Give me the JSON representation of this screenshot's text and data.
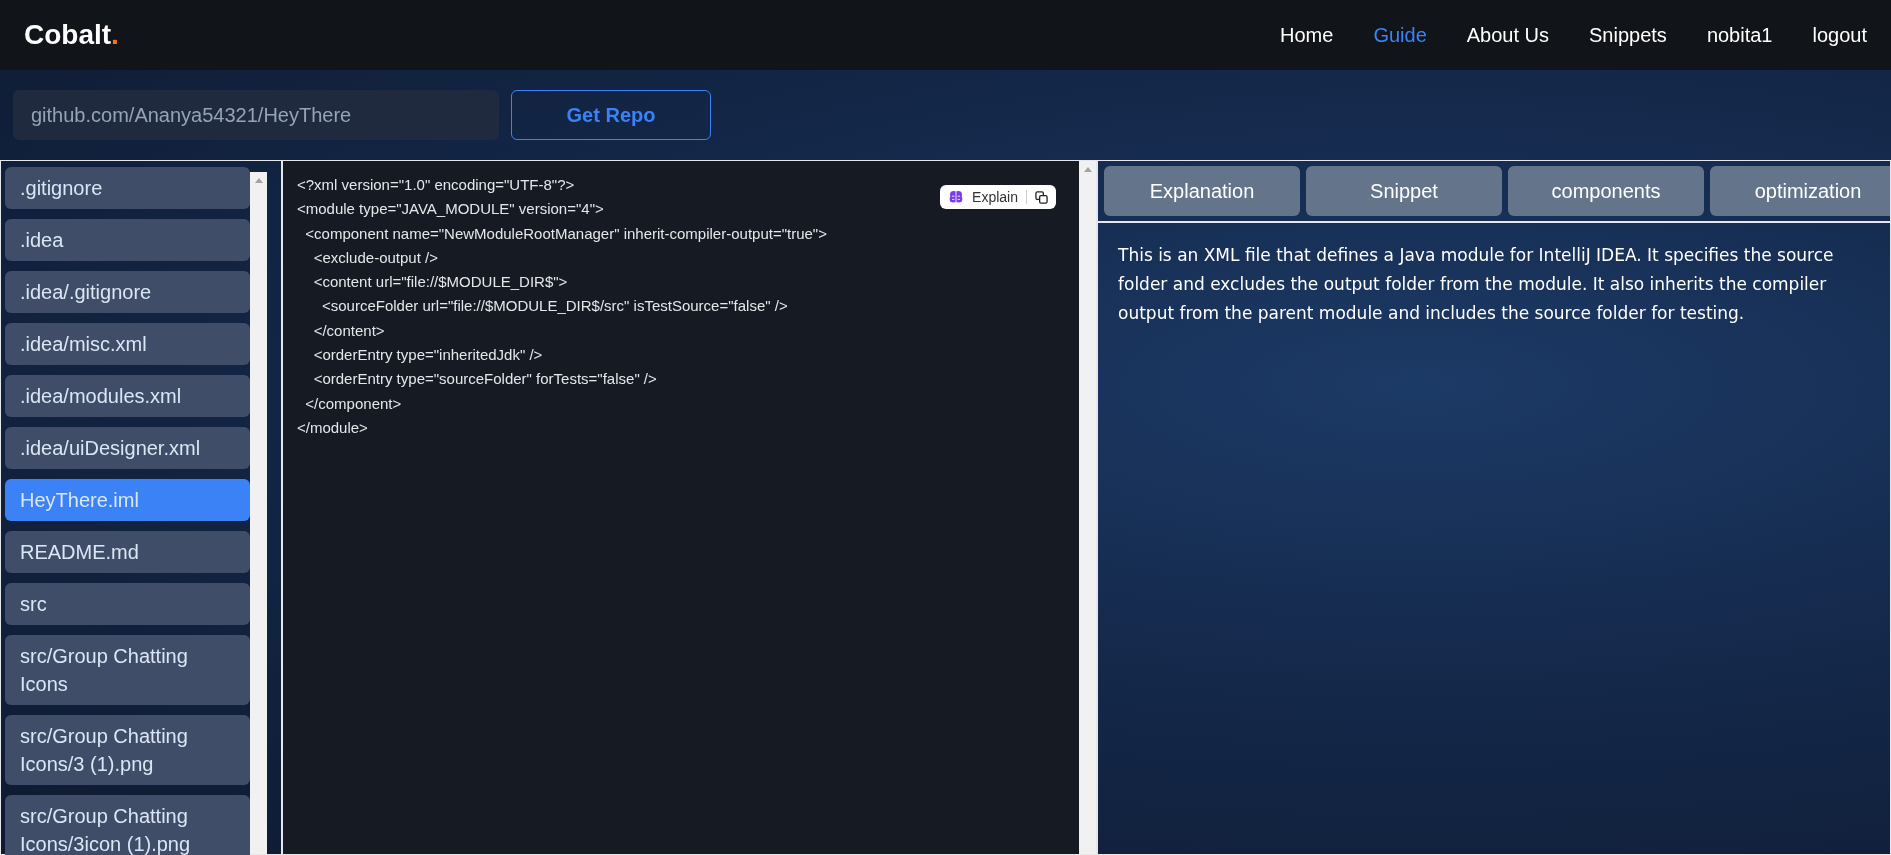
{
  "brand": {
    "name": "Cobalt",
    "dot": "."
  },
  "nav": [
    {
      "label": "Home",
      "selected": false
    },
    {
      "label": "Guide",
      "selected": true
    },
    {
      "label": "About Us",
      "selected": false
    },
    {
      "label": "Snippets",
      "selected": false
    },
    {
      "label": "nobita1",
      "selected": false
    },
    {
      "label": "logout",
      "selected": false
    }
  ],
  "repo": {
    "value": "github.com/Ananya54321/HeyThere",
    "button": "Get Repo"
  },
  "files": [
    {
      "name": ".gitignore",
      "selected": false
    },
    {
      "name": ".idea",
      "selected": false
    },
    {
      "name": ".idea/.gitignore",
      "selected": false
    },
    {
      "name": ".idea/misc.xml",
      "selected": false
    },
    {
      "name": ".idea/modules.xml",
      "selected": false
    },
    {
      "name": ".idea/uiDesigner.xml",
      "selected": false
    },
    {
      "name": "HeyThere.iml",
      "selected": true
    },
    {
      "name": "README.md",
      "selected": false
    },
    {
      "name": "src",
      "selected": false
    },
    {
      "name": "src/Group Chatting Icons",
      "selected": false
    },
    {
      "name": "src/Group Chatting Icons/3 (1).png",
      "selected": false
    },
    {
      "name": "src/Group Chatting Icons/3icon (1).png",
      "selected": false
    }
  ],
  "code": {
    "explain_button": "Explain",
    "lines": [
      "<?xml version=\"1.0\" encoding=\"UTF-8\"?>",
      "<module type=\"JAVA_MODULE\" version=\"4\">",
      "  <component name=\"NewModuleRootManager\" inherit-compiler-output=\"true\">",
      "    <exclude-output />",
      "    <content url=\"file://$MODULE_DIR$\">",
      "      <sourceFolder url=\"file://$MODULE_DIR$/src\" isTestSource=\"false\" />",
      "    </content>",
      "    <orderEntry type=\"inheritedJdk\" />",
      "    <orderEntry type=\"sourceFolder\" forTests=\"false\" />",
      "  </component>",
      "</module>"
    ]
  },
  "tabs": [
    "Explanation",
    "Snippet",
    "components",
    "optimization"
  ],
  "explanation": "This is an XML file that defines a Java module for IntelliJ IDEA. It specifies the source folder and excludes the output folder from the module. It also inherits the compiler output from the parent module and includes the source folder for testing."
}
